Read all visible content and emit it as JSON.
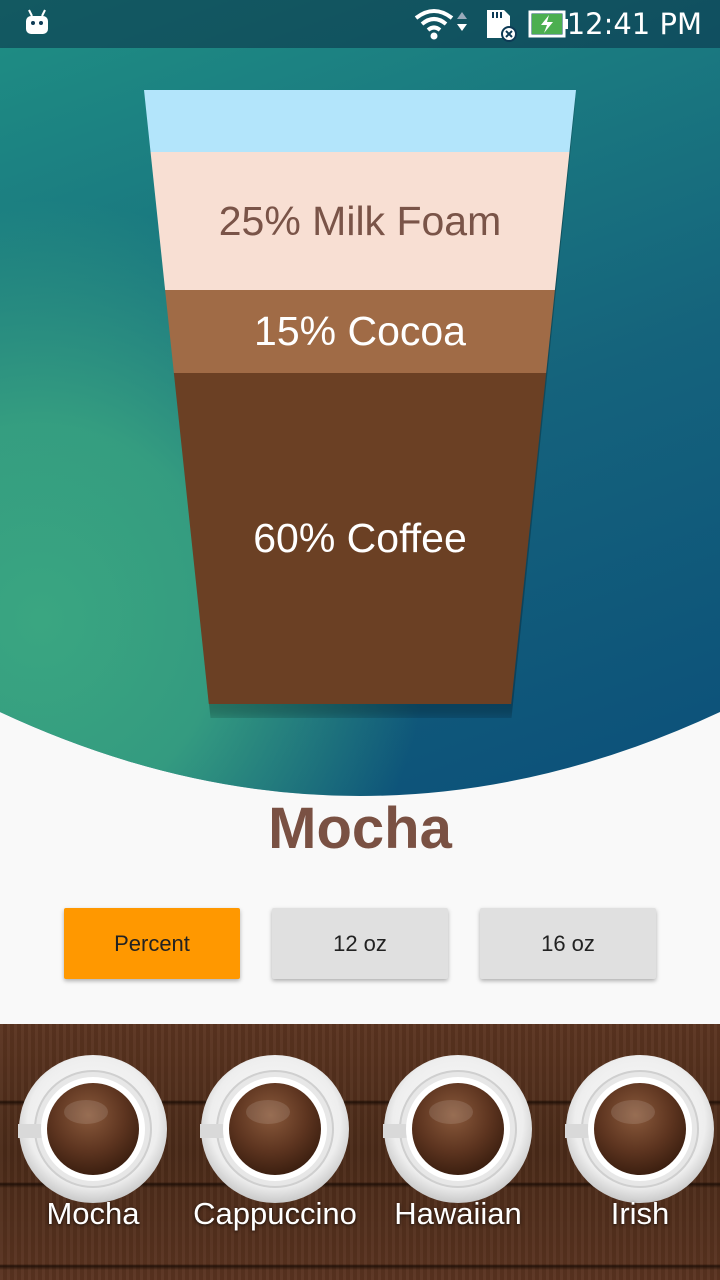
{
  "status_bar": {
    "time": "12:41 PM",
    "icons": [
      "android-debug-icon",
      "wifi-icon",
      "sd-card-icon",
      "battery-charging-icon"
    ]
  },
  "drink": {
    "name": "Mocha",
    "layers": [
      {
        "label": "",
        "color": "#b3e5fb"
      },
      {
        "label": "25% Milk Foam",
        "color": "#f8dfd3"
      },
      {
        "label": "15% Cocoa",
        "color": "#a06b46"
      },
      {
        "label": "60% Coffee",
        "color": "#6b4024"
      }
    ]
  },
  "size_buttons": [
    {
      "label": "Percent",
      "selected": true,
      "color": "#ff9800"
    },
    {
      "label": "12 oz",
      "selected": false,
      "color": "#e0e0e0"
    },
    {
      "label": "16 oz",
      "selected": false,
      "color": "#e0e0e0"
    }
  ],
  "coffee_menu": [
    {
      "label": "Mocha"
    },
    {
      "label": "Cappuccino"
    },
    {
      "label": "Hawaiian"
    },
    {
      "label": "Irish"
    }
  ],
  "colors": {
    "title": "#7a5143",
    "accent": "#ff9800",
    "hero_teal": "#3aa681",
    "hero_blue": "#0b4f79"
  }
}
